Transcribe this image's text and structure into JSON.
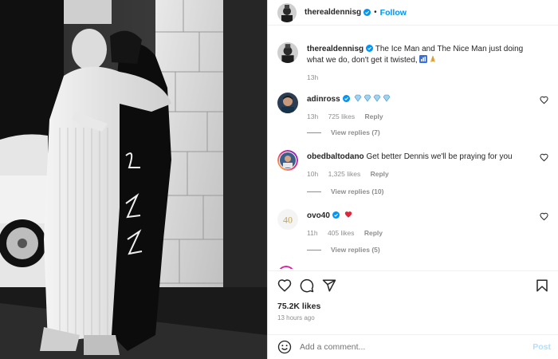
{
  "header": {
    "username": "therealdennisg",
    "separator": "•",
    "follow_label": "Follow"
  },
  "caption": {
    "username": "therealdennisg",
    "text": "The Ice Man and The Nice Man just doing what we do, don't get it twisted,",
    "emojis": [
      "bar-chart-emoji",
      "praying-hands-emoji"
    ],
    "time": "13h"
  },
  "comments": [
    {
      "username": "adinross",
      "text": "",
      "emojis": [
        "gem-emoji",
        "gem-emoji",
        "gem-emoji",
        "gem-emoji"
      ],
      "time": "13h",
      "likes": "725 likes",
      "reply_label": "Reply",
      "view_replies": "View replies (7)"
    },
    {
      "username": "obedbaltodano",
      "text": "Get better Dennis we'll be praying for you",
      "time": "10h",
      "likes": "1,325 likes",
      "reply_label": "Reply",
      "view_replies": "View replies (10)"
    },
    {
      "username": "ovo40",
      "text": "",
      "emojis": [
        "red-heart-emoji"
      ],
      "time": "11h",
      "likes": "405 likes",
      "reply_label": "Reply",
      "view_replies": "View replies (5)"
    }
  ],
  "actions": {
    "icons": [
      "heart-icon",
      "comment-icon",
      "share-icon",
      "bookmark-icon"
    ]
  },
  "likes": "75.2K likes",
  "posted": "13 hours ago",
  "add_comment": {
    "placeholder": "Add a comment...",
    "post_label": "Post"
  },
  "colors": {
    "accent": "#0095f6",
    "post_disabled": "#b2dffc",
    "muted": "#8e8e8e",
    "heart_red": "#ed4956"
  }
}
